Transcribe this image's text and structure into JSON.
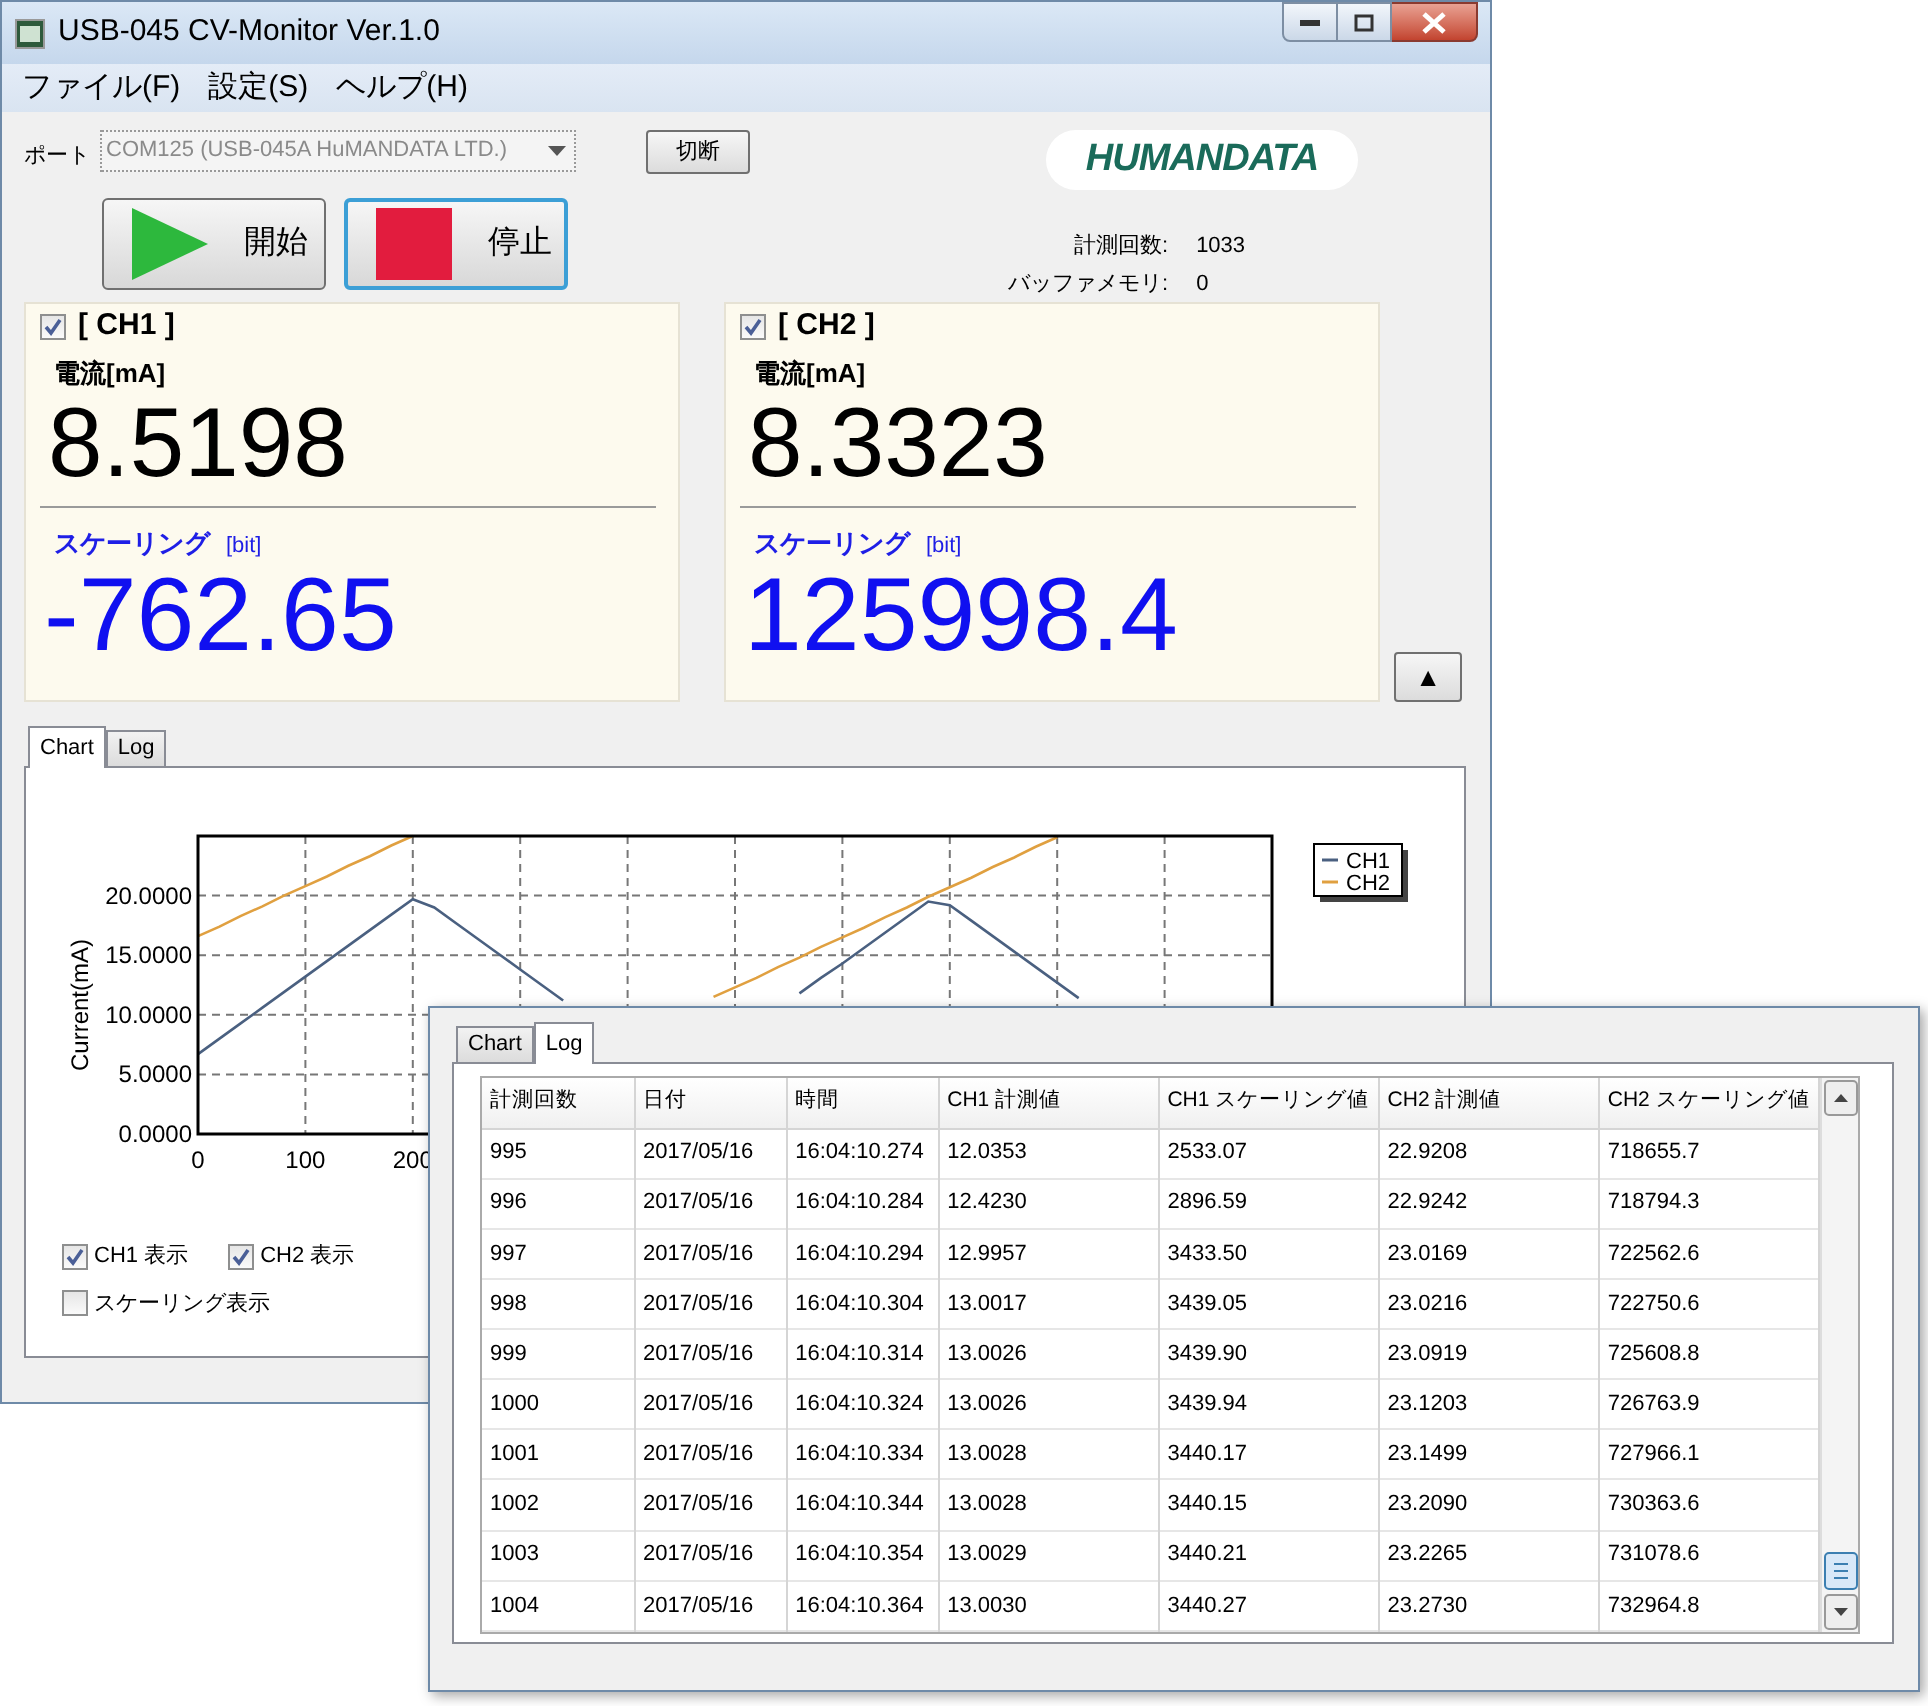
{
  "window": {
    "title": "USB-045 CV-Monitor Ver.1.0"
  },
  "menu": [
    {
      "label": "ファイル(F)"
    },
    {
      "label": "設定(S)"
    },
    {
      "label": "ヘルプ(H)"
    }
  ],
  "port": {
    "label": "ポート",
    "value": "COM125 (USB-045A HuMANDATA LTD.)",
    "disabled": true
  },
  "disconnect_button": {
    "label": "切断"
  },
  "logo": {
    "text": "HUMANDATA"
  },
  "run_buttons": [
    {
      "kind": "start",
      "label": "開始",
      "focused": false
    },
    {
      "kind": "stop",
      "label": "停止",
      "focused": true
    }
  ],
  "stats": [
    {
      "label": "計測回数:",
      "value": "1033"
    },
    {
      "label": "バッファメモリ:",
      "value": "0"
    }
  ],
  "channels": [
    {
      "checked": true,
      "title": "[ CH1 ]",
      "current_label": "電流[mA]",
      "current_value": "8.5198",
      "scaling_label": "スケーリング",
      "scaling_unit": "[bit]",
      "scaling_value": "-762.65"
    },
    {
      "checked": true,
      "title": "[ CH2 ]",
      "current_label": "電流[mA]",
      "current_value": "8.3323",
      "scaling_label": "スケーリング",
      "scaling_unit": "[bit]",
      "scaling_value": "125998.4"
    }
  ],
  "collapse_button": {
    "label": "▲"
  },
  "tabs": [
    {
      "label": "Chart",
      "selected": true
    },
    {
      "label": "Log",
      "selected": false
    }
  ],
  "chart": {
    "chart_data": {
      "type": "line",
      "ylabel": "Current(mA)",
      "xlim": [
        0,
        1000
      ],
      "ylim": [
        0,
        25
      ],
      "xticks": [
        0,
        100,
        200
      ],
      "yticks": [
        {
          "value": 0,
          "label": "0.0000"
        },
        {
          "value": 5,
          "label": "5.0000"
        },
        {
          "value": 10,
          "label": "10.0000"
        },
        {
          "value": 15,
          "label": "15.0000"
        },
        {
          "value": 20,
          "label": "20.0000"
        }
      ],
      "x": [
        0,
        20,
        40,
        60,
        80,
        100,
        120,
        140,
        160,
        180,
        200,
        220,
        240,
        260,
        280,
        300,
        320,
        340,
        480,
        500,
        520,
        540,
        560,
        580,
        600,
        620,
        640,
        660,
        680,
        700,
        720,
        740,
        760,
        780,
        800,
        820
      ],
      "series": [
        {
          "name": "CH1",
          "color": "#4a6080",
          "values": [
            6.7,
            8.0,
            9.3,
            10.6,
            11.9,
            13.2,
            14.5,
            15.8,
            17.1,
            18.4,
            19.7,
            19.0,
            17.7,
            16.4,
            15.1,
            13.8,
            12.5,
            11.2,
            null,
            null,
            null,
            null,
            11.8,
            13.1,
            14.3,
            15.6,
            16.9,
            18.2,
            19.5,
            19.2,
            17.9,
            16.6,
            15.3,
            14.0,
            12.7,
            11.4
          ]
        },
        {
          "name": "CH2",
          "color": "#e0a040",
          "values": [
            16.6,
            17.4,
            18.3,
            19.1,
            20.0,
            20.8,
            21.6,
            22.5,
            23.3,
            24.2,
            25.0,
            null,
            null,
            null,
            null,
            null,
            null,
            null,
            11.5,
            12.3,
            13.1,
            14.0,
            14.8,
            15.7,
            16.5,
            17.3,
            18.2,
            19.0,
            19.9,
            20.7,
            21.5,
            22.4,
            23.2,
            24.1,
            24.9,
            null
          ]
        }
      ],
      "grid": true,
      "legend": true
    }
  },
  "options": [
    {
      "label": "CH1 表示",
      "checked": true
    },
    {
      "label": "CH2 表示",
      "checked": true
    },
    {
      "label": "スケーリング表示",
      "checked": false
    }
  ],
  "log_window": {
    "tabs": [
      {
        "label": "Chart",
        "selected": false
      },
      {
        "label": "Log",
        "selected": true
      }
    ],
    "table": {
      "columns": [
        "計測回数",
        "日付",
        "時間",
        "CH1 計測値",
        "CH1 スケーリング値",
        "CH2 計測値",
        "CH2 スケーリング値"
      ],
      "rows": [
        [
          "995",
          "2017/05/16",
          "16:04:10.274",
          "12.0353",
          "2533.07",
          "22.9208",
          "718655.7"
        ],
        [
          "996",
          "2017/05/16",
          "16:04:10.284",
          "12.4230",
          "2896.59",
          "22.9242",
          "718794.3"
        ],
        [
          "997",
          "2017/05/16",
          "16:04:10.294",
          "12.9957",
          "3433.50",
          "23.0169",
          "722562.6"
        ],
        [
          "998",
          "2017/05/16",
          "16:04:10.304",
          "13.0017",
          "3439.05",
          "23.0216",
          "722750.6"
        ],
        [
          "999",
          "2017/05/16",
          "16:04:10.314",
          "13.0026",
          "3439.90",
          "23.0919",
          "725608.8"
        ],
        [
          "1000",
          "2017/05/16",
          "16:04:10.324",
          "13.0026",
          "3439.94",
          "23.1203",
          "726763.9"
        ],
        [
          "1001",
          "2017/05/16",
          "16:04:10.334",
          "13.0028",
          "3440.17",
          "23.1499",
          "727966.1"
        ],
        [
          "1002",
          "2017/05/16",
          "16:04:10.344",
          "13.0028",
          "3440.15",
          "23.2090",
          "730363.6"
        ],
        [
          "1003",
          "2017/05/16",
          "16:04:10.354",
          "13.0029",
          "3440.21",
          "23.2265",
          "731078.6"
        ],
        [
          "1004",
          "2017/05/16",
          "16:04:10.364",
          "13.0030",
          "3440.27",
          "23.2730",
          "732964.8"
        ]
      ]
    }
  }
}
